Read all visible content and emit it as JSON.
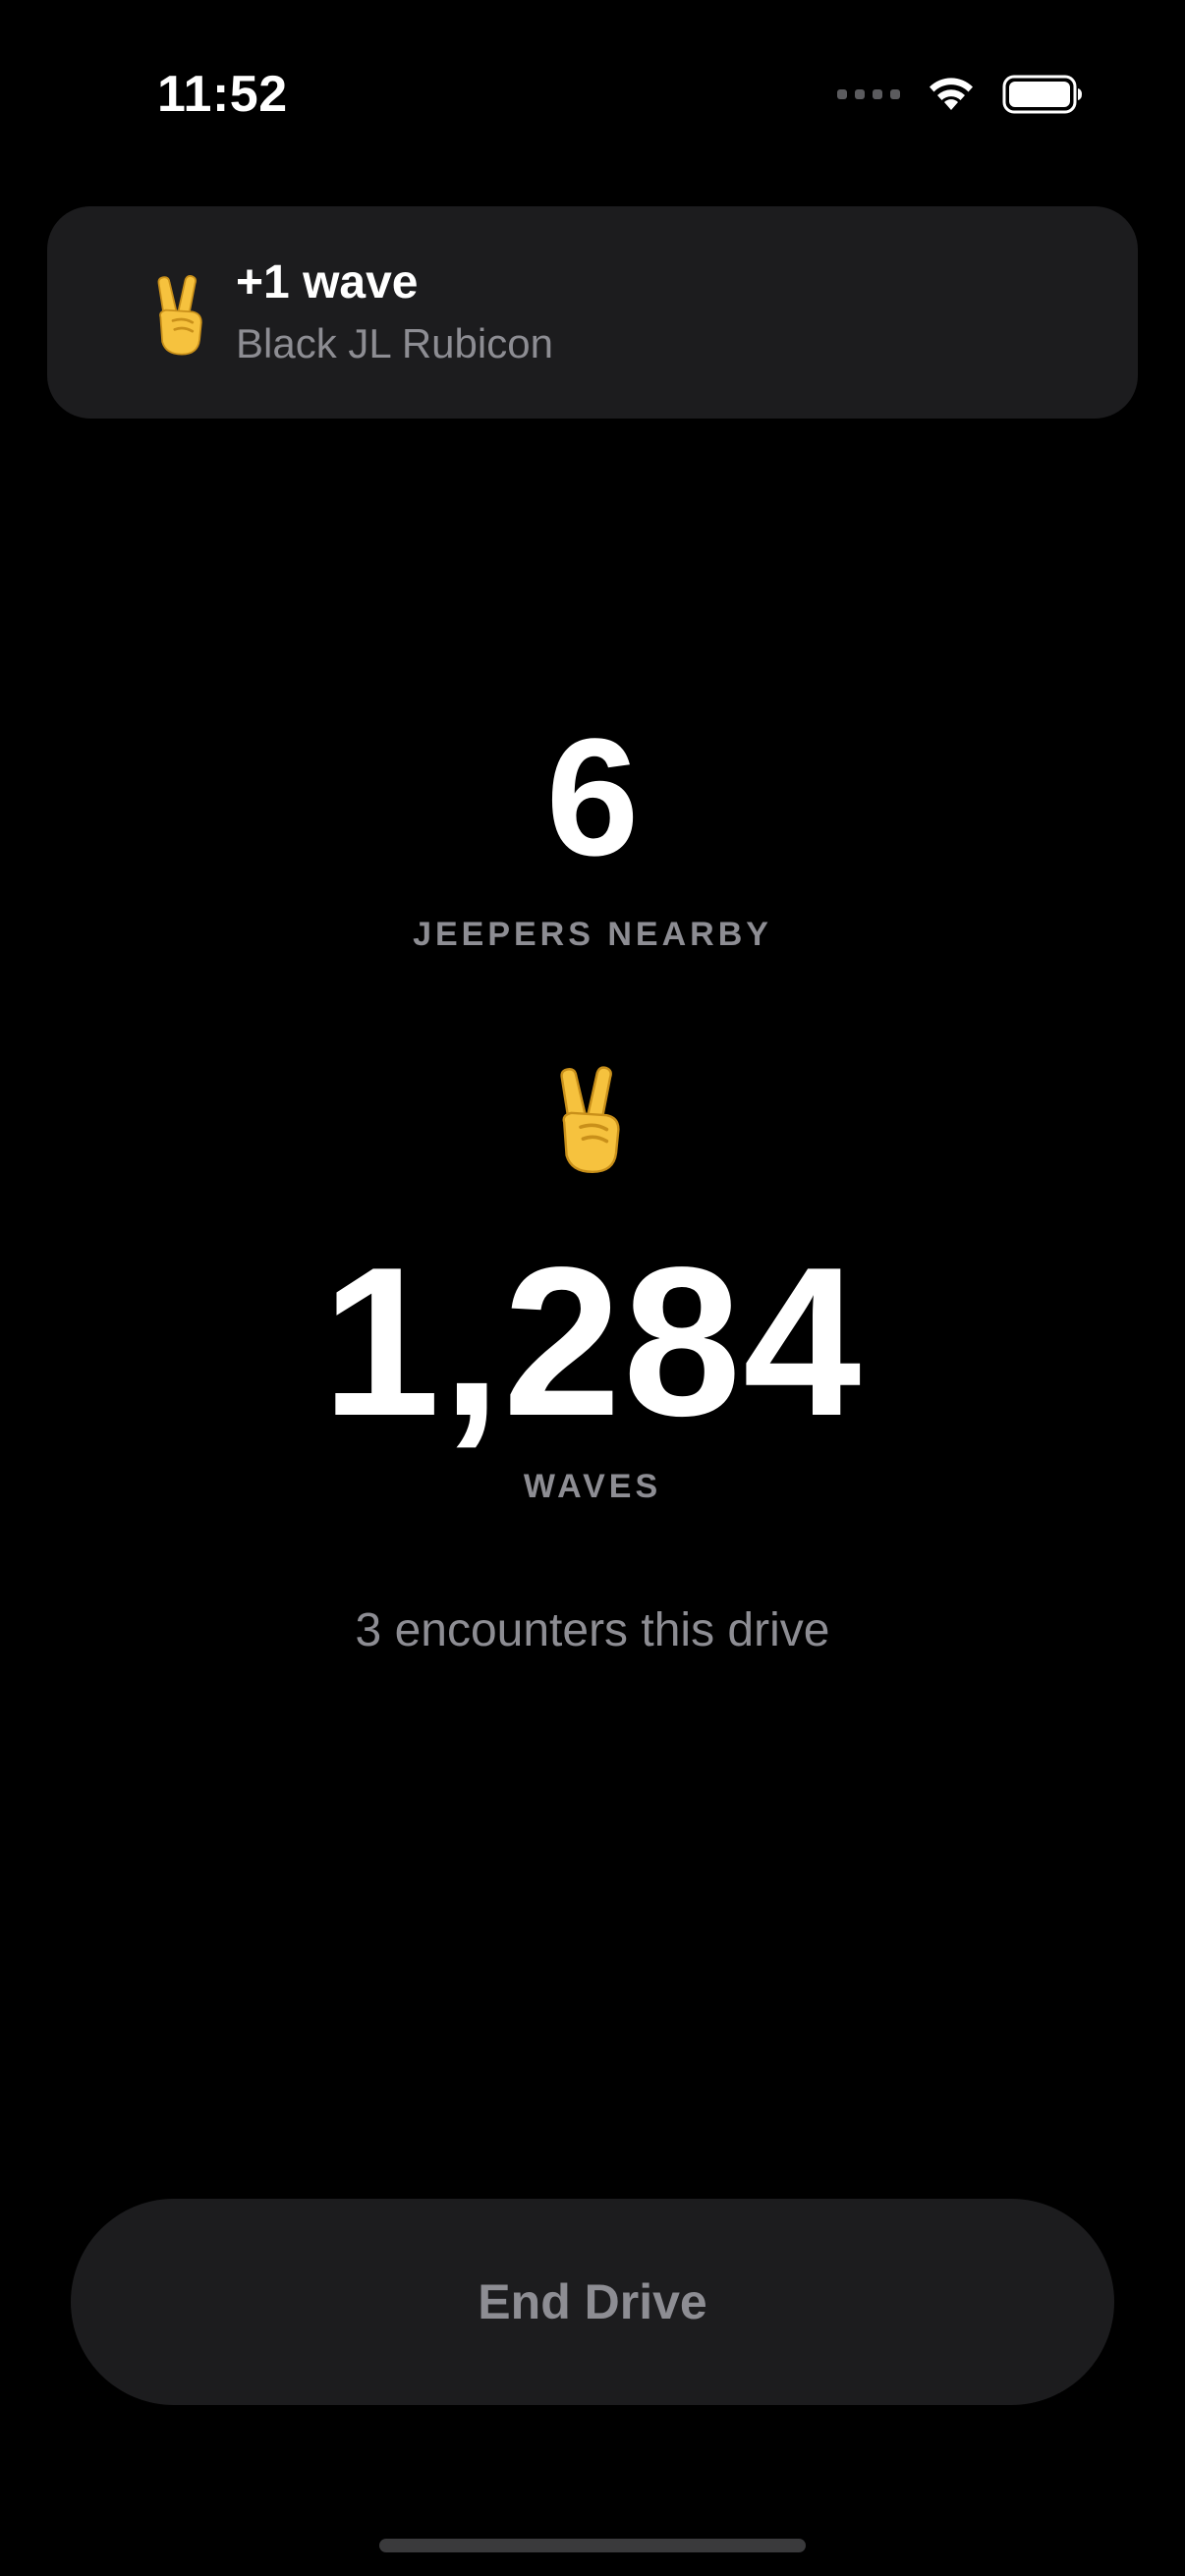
{
  "status_bar": {
    "time": "11:52",
    "icons": [
      "signal-dots-icon",
      "wifi-icon",
      "battery-icon"
    ]
  },
  "banner": {
    "icon": "victory-hand-icon",
    "title": "+1 wave",
    "subtitle": "Black JL Rubicon"
  },
  "stats": {
    "nearby_count": "6",
    "nearby_label": "JEEPERS NEARBY",
    "wave_icon": "victory-hand-icon",
    "waves_count": "1,284",
    "waves_label": "WAVES",
    "encounters_text": "3 encounters this drive"
  },
  "actions": {
    "end_drive_label": "End Drive"
  },
  "colors": {
    "background": "#000000",
    "card": "#1c1c1e",
    "primary_text": "#ffffff",
    "secondary_text": "#8d8d93",
    "emoji_yellow": "#f6c23e"
  }
}
